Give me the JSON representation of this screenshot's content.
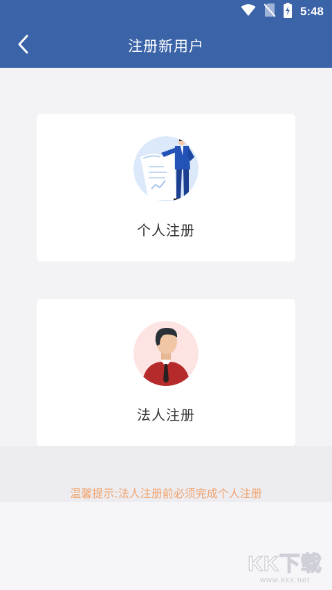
{
  "status_bar": {
    "time": "5:48",
    "icons": [
      "wifi-icon",
      "no-sim-icon",
      "battery-charging-icon"
    ]
  },
  "header": {
    "title": "注册新用户",
    "back_icon": "chevron-left-icon"
  },
  "options": [
    {
      "label": "个人注册",
      "icon": "businessman-document-illustration"
    },
    {
      "label": "法人注册",
      "icon": "man-in-red-suit-avatar"
    }
  ],
  "tip": "温馨提示:法人注册前必须完成个人注册",
  "watermark": {
    "logo": "KK下载",
    "url": "www.kkx.net"
  },
  "colors": {
    "header_bg": "#3a63a8",
    "page_bg": "#f3f3f5",
    "tip_text": "#f2a36b",
    "card_bg": "#ffffff"
  }
}
